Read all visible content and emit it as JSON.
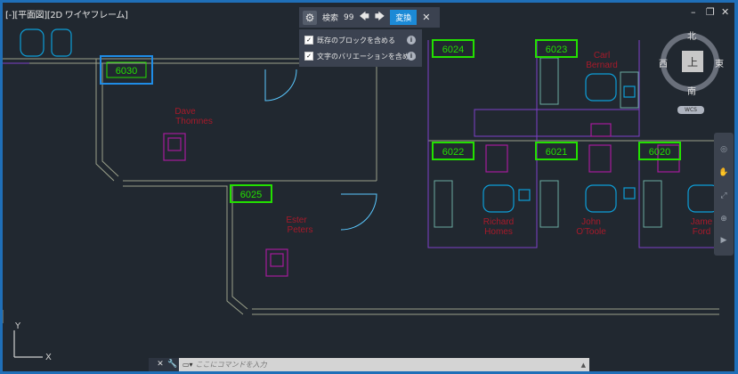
{
  "viewport": {
    "label": "[-][平面図][2D ワイヤフレーム]"
  },
  "window_controls": {
    "minimize": "–",
    "restore": "❐",
    "close": "✕"
  },
  "find": {
    "gear": "⚙",
    "label": "検索",
    "count": "99",
    "prev": "🡄",
    "next": "🡆",
    "replace_label": "変換",
    "close": "✕",
    "options": [
      {
        "label": "既存のブロックを含める",
        "checked": true
      },
      {
        "label": "文字のバリエーションを含める",
        "checked": true
      }
    ],
    "info": "i"
  },
  "compass": {
    "north": "北",
    "south": "南",
    "east": "東",
    "west": "西",
    "center": "上",
    "wcs": "WCS"
  },
  "rooms": [
    {
      "number": "6030",
      "selected": true
    },
    {
      "number": "6024"
    },
    {
      "number": "6023"
    },
    {
      "number": "6022"
    },
    {
      "number": "6021"
    },
    {
      "number": "6020"
    },
    {
      "number": "6025"
    }
  ],
  "names": [
    [
      "Dave",
      "Thomnes"
    ],
    [
      "Carl",
      "Bernard"
    ],
    [
      "Ester",
      "Peters"
    ],
    [
      "Richard",
      "Homes"
    ],
    [
      "John",
      "O'Toole"
    ],
    [
      "Jame",
      "Ford"
    ]
  ],
  "command": {
    "close": "✕",
    "tool": "🔧",
    "prompt": "▭▾",
    "placeholder": "ここにコマンドを入力",
    "up": "▲"
  },
  "ucs": {
    "x": "X",
    "y": "Y"
  },
  "nav": [
    "◎",
    "✋",
    "⤢",
    "⊕",
    "▶"
  ],
  "colors": {
    "frame": "#1f6fb8",
    "bg": "#212830",
    "wall": "#9aa08a",
    "room_tag": "#23e000",
    "furniture": "#a51b9b",
    "desk": "#0d9ed8",
    "name": "#a81a2a"
  }
}
